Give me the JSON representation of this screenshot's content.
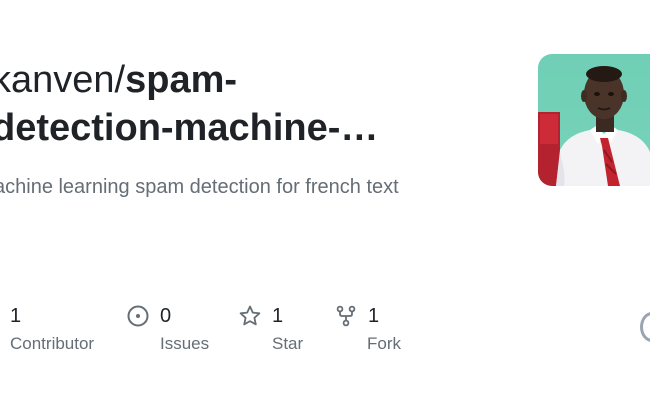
{
  "repo": {
    "owner_line": "kanven/",
    "name_part1": "spam-",
    "name_part2": "detection-machine-…",
    "description": "achine learning spam detection for french text"
  },
  "stats": {
    "contributors": {
      "count": "1",
      "label": "Contributor",
      "icon": "people-icon"
    },
    "issues": {
      "count": "0",
      "label": "Issues",
      "icon": "issue-icon"
    },
    "stars": {
      "count": "1",
      "label": "Star",
      "icon": "star-icon"
    },
    "forks": {
      "count": "1",
      "label": "Fork",
      "icon": "fork-icon"
    }
  },
  "colors": {
    "text": "#1f2328",
    "muted": "#656d76",
    "avatar_bg": "#72d0b7"
  }
}
